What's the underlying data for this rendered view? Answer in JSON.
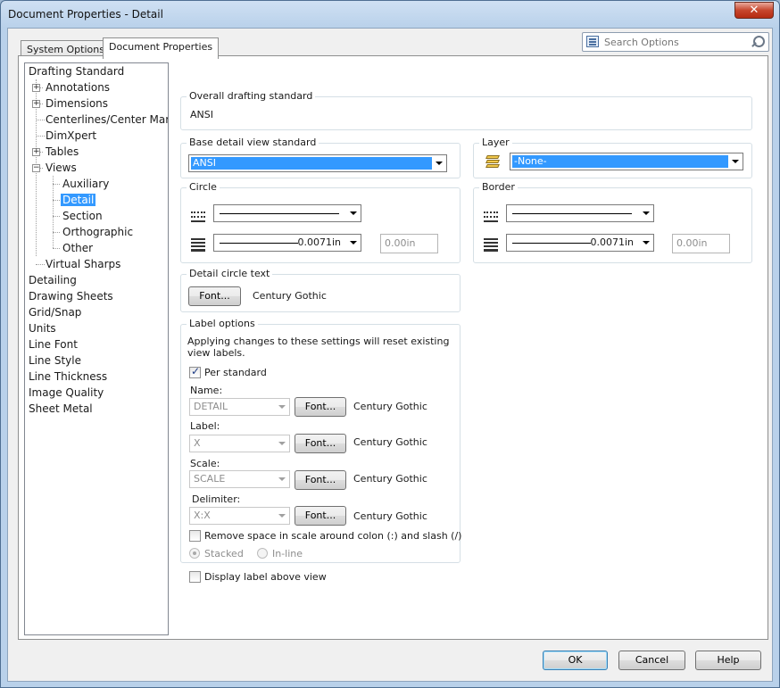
{
  "window": {
    "title": "Document Properties - Detail",
    "close_glyph": "✕"
  },
  "tabs": [
    {
      "label": "System Options"
    },
    {
      "label": "Document Properties"
    }
  ],
  "search": {
    "placeholder": "Search Options"
  },
  "tree": {
    "items": [
      {
        "label": "Drafting Standard"
      },
      {
        "label": "Annotations"
      },
      {
        "label": "Dimensions"
      },
      {
        "label": "Centerlines/Center Marks"
      },
      {
        "label": "DimXpert"
      },
      {
        "label": "Tables"
      },
      {
        "label": "Views"
      },
      {
        "label": "Auxiliary"
      },
      {
        "label": "Detail"
      },
      {
        "label": "Section"
      },
      {
        "label": "Orthographic"
      },
      {
        "label": "Other"
      },
      {
        "label": "Virtual Sharps"
      },
      {
        "label": "Detailing"
      },
      {
        "label": "Drawing Sheets"
      },
      {
        "label": "Grid/Snap"
      },
      {
        "label": "Units"
      },
      {
        "label": "Line Font"
      },
      {
        "label": "Line Style"
      },
      {
        "label": "Line Thickness"
      },
      {
        "label": "Image Quality"
      },
      {
        "label": "Sheet Metal"
      }
    ],
    "expand_glyph": "+",
    "collapse_glyph": "−"
  },
  "overall": {
    "label": "Overall drafting standard",
    "value": "ANSI"
  },
  "base_detail": {
    "label": "Base detail view standard",
    "value": "ANSI"
  },
  "layer": {
    "label": "Layer",
    "value": "-None-"
  },
  "circle": {
    "label": "Circle",
    "thickness": "0.0071in",
    "custom": "0.00in"
  },
  "border": {
    "label": "Border",
    "thickness": "0.0071in",
    "custom": "0.00in"
  },
  "detail_circle_text": {
    "label": "Detail circle text",
    "font_button": "Font...",
    "font_name": "Century Gothic"
  },
  "label_options": {
    "label": "Label options",
    "note_line1": "Applying changes to these settings will reset existing",
    "note_line2": "view labels.",
    "per_standard": "Per standard",
    "name_label": "Name:",
    "name_value": "DETAIL",
    "label_label": "Label:",
    "label_value": "X",
    "scale_label": "Scale:",
    "scale_value": "SCALE",
    "delimiter_label": "Delimiter:",
    "delimiter_value": "X:X",
    "font_button": "Font...",
    "font_name": "Century Gothic",
    "remove_space": "Remove space in scale around colon (:) and slash (/)",
    "stacked": "Stacked",
    "inline": "In-line"
  },
  "display_label_above": "Display label above view",
  "buttons": {
    "ok": "OK",
    "cancel": "Cancel",
    "help": "Help"
  },
  "colors": {
    "selection": "#3399ff",
    "title_bar": "#b9d1ea",
    "close_button": "#c7462d"
  }
}
